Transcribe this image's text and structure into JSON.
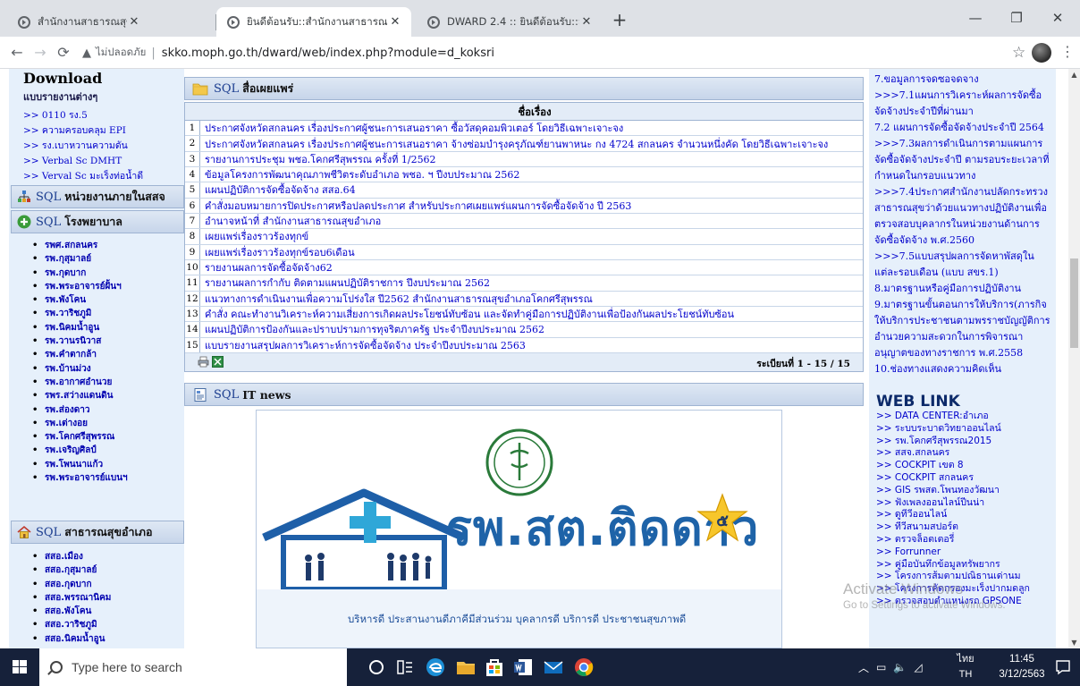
{
  "browser": {
    "tabs": [
      {
        "title": "สำนักงานสาธารณสุขจังหวัดสกลนคร"
      },
      {
        "title": "ยินดีต้อนรับ::สำนักงานสาธารณสุขอำเ"
      },
      {
        "title": "DWARD 2.4 :: ยินดีต้อนรับ::สำนักงาน"
      }
    ],
    "not_secure_label": "ไม่ปลอดภัย",
    "url": "skko.moph.go.th/dward/web/index.php?module=d_koksri"
  },
  "left": {
    "download_title": "Download",
    "download_sub": "แบบรายงานต่างๆ",
    "download_links": [
      ">> 0110 รง.5",
      ">> ความครอบคลุม EPI",
      ">> รง.เบาหวานความดัน",
      ">> Verbal Sc DMHT",
      ">> Verval Sc มะเร็งท่อน้ำดี"
    ],
    "section1": {
      "sql": "SQL",
      "name": "หน่วยงานภายในสสจ"
    },
    "section2": {
      "sql": "SQL",
      "name": "โรงพยาบาล"
    },
    "hospitals": [
      "รพศ.สกลนคร",
      "รพ.กุสุมาลย์",
      "รพ.กุดบาก",
      "รพ.พระอาจารย์ฝั้นฯ",
      "รพ.พังโคน",
      "รพ.วาริชภูมิ",
      "รพ.นิคมน้ำอูน",
      "รพ.วานรนิวาส",
      "รพ.คำตากล้า",
      "รพ.บ้านม่วง",
      "รพ.อากาศอำนวย",
      "รพร.สว่างแดนดิน",
      "รพ.ส่องดาว",
      "รพ.เต่างอย",
      "รพ.โคกศรีสุพรรณ",
      "รพ.เจริญศิลป์",
      "รพ.โพนนาแก้ว",
      "รพ.พระอาจารย์แบนฯ"
    ],
    "section3": {
      "sql": "SQL",
      "name": "สาธารณสุขอำเภอ"
    },
    "districts": [
      "สสอ.เมือง",
      "สสอ.กุสุมาลย์",
      "สสอ.กุดบาก",
      "สสอ.พรรณานิคม",
      "สสอ.พังโคน",
      "สสอ.วาริชภูมิ",
      "สสอ.นิคมน้ำอูน"
    ]
  },
  "main": {
    "panel1": {
      "sql": "SQL",
      "name": "สื่อเผยแพร่"
    },
    "table_header": "ชื่อเรื่อง",
    "rows": [
      {
        "num": "1",
        "title": "ประกาศจังหวัดสกลนคร เรื่องประกาศผู้ชนะการเสนอราคา ซื้อวัสดุคอมพิวเตอร์ โดยวิธีเฉพาะเจาะจง"
      },
      {
        "num": "2",
        "title": "ประกาศจังหวัดสกลนคร เรื่องประกาศผู้ชนะการเสนอราคา จ้างซ่อมบำรุงครุภัณฑ์ยานพาหนะ กง 4724 สกลนคร จำนวนหนึ่งคัด โดยวิธีเฉพาะเจาะจง"
      },
      {
        "num": "3",
        "title": "รายงานการประชุม พชอ.โคกศรีสุพรรณ ครั้งที่ 1/2562"
      },
      {
        "num": "4",
        "title": "ข้อมูลโครงการพัฒนาคุณภาพชีวิตระดับอำเภอ พชอ. ฯ ปีงบประมาณ 2562"
      },
      {
        "num": "5",
        "title": "แผนปฏิบัติการจัดซื้อจัดจ้าง สสอ.64"
      },
      {
        "num": "6",
        "title": "คำสั่งมอบหมายการปิดประกาศหรือปลดประกาศ สำหรับประกาศเผยแพร่แผนการจัดซื้อจัดจ้าง ปี 2563"
      },
      {
        "num": "7",
        "title": "อำนาจหน้าที่ สำนักงานสาธารณสุขอำเภอ"
      },
      {
        "num": "8",
        "title": "เผยแพร่เรื่องราวร้องทุกข์"
      },
      {
        "num": "9",
        "title": "เผยแพร่เรื่องราวร้องทุกข์รอบ6เดือน"
      },
      {
        "num": "10",
        "title": "รายงานผลการจัดซื้อจัดจ้าง62"
      },
      {
        "num": "11",
        "title": "รายงานผลการกำกับ ติดตามแผนปฏิบัติราชการ ปีงบประมาณ 2562"
      },
      {
        "num": "12",
        "title": "แนวทางการดำเนินงานเพื่อความโปร่งใส ปี2562 สำนักงานสาธารณสุขอำเภอโคกศรีสุพรรณ"
      },
      {
        "num": "13",
        "title": "คำสั่ง คณะทำงานวิเคราะห์ความเสี่ยงการเกิดผลประโยชน์ทับซ้อน และจัดทำคู่มือการปฏิบัติงานเพื่อป้องกันผลประโยชน์ทับซ้อน"
      },
      {
        "num": "14",
        "title": "แผนปฏิบัติการป้องกันและปราบปรามการทุจริตภาครัฐ ประจำปีงบประมาณ 2562"
      },
      {
        "num": "15",
        "title": "แบบรายงานสรุปผลการวิเคราะห์การจัดซื้อจัดจ้าง ประจำปีงบประมาณ 2563"
      }
    ],
    "pager": "ระเบียนที่ 1 - 15 / 15",
    "panel2": {
      "sql": "SQL",
      "name": "IT news"
    },
    "banner_title": "รพ.สต.ติดดาว",
    "banner_star_num": "๕",
    "banner_slogan": "บริหารดี  ประสานงานดีภาคีมีส่วนร่วม  บุคลากรดี  บริการดี  ประชาชนสุขภาพดี"
  },
  "right": {
    "top_links": [
      "7.ขอมูลการจดซอจดจาง",
      ">>>7.1แผนการวิเคราะห์ผลการจัดซื้อจัดจ้างประจำปีที่ผ่านมา",
      "7.2 แผนการจัดซื้อจัดจ้างประจำปี 2564",
      ">>>7.3ผลการดำเนินการตามแผนการจัดซื้อจัดจ้างประจำปี ตามรอบระยะเวลาที่กำหนดในกรอบแนวทาง",
      ">>>7.4ประกาศสำนักงานปลัดกระทรวงสาธารณสุขว่าด้วยแนวทางปฏิบัติงานเพื่อตรวจสอบบุคลากรในหน่วยงานด้านการจัดซื้อจัดจ้าง พ.ศ.2560",
      ">>>7.5แบบสรุปผลการจัดหาพัสดุในแต่ละรอบเดือน (แบบ สขร.1)",
      "8.มาตรฐานหรือคู่มือการปฏิบัติงาน",
      "9.มาตรฐานขั้นตอนการให้บริการ(ภารกิจให้บริการประชาชนตามพรราชบัญญัติการอำนวยความสะดวกในการพิจารณาอนุญาตของทางราชการ พ.ศ.2558",
      "10.ช่องทางแสดงความคิดเห็น"
    ],
    "weblink_title": "WEB LINK",
    "weblinks": [
      ">> DATA CENTER:อำเภอ",
      ">> ระบบระบาดวิทยาออนไลน์",
      ">> รพ.โคกศรีสุพรรณ2015",
      ">> สสจ.สกลนคร",
      ">> COCKPIT เขต 8",
      ">> COCKPIT สกลนคร",
      ">> GIS รพสต.โพนทองวัฒนา",
      ">> ฟังเพลงออนไลน์ปีนน่า",
      ">> ดูทีวีออนไลน์",
      ">> ทีวีสนามสปอร์ต",
      ">> ตรวจล็อตเตอรี่",
      ">> Forrunner",
      ">> คู่มือบันทึกข้อมูลทรัพยากร",
      ">> โครงการส้มตามปณิธานเด่านม",
      ">> โครงการคัดกรองมะเร็งปากมดลูก",
      ">> ตรวจสอบตำแหน่งรถ GPSONE"
    ]
  },
  "watermark": {
    "line1": "Activate Windows",
    "line2": "Go to Settings to activate Windows."
  },
  "taskbar": {
    "search_placeholder": "Type here to search",
    "lang_line1": "ไทย",
    "lang_line2": "TH",
    "time": "11:45",
    "date": "3/12/2563"
  }
}
